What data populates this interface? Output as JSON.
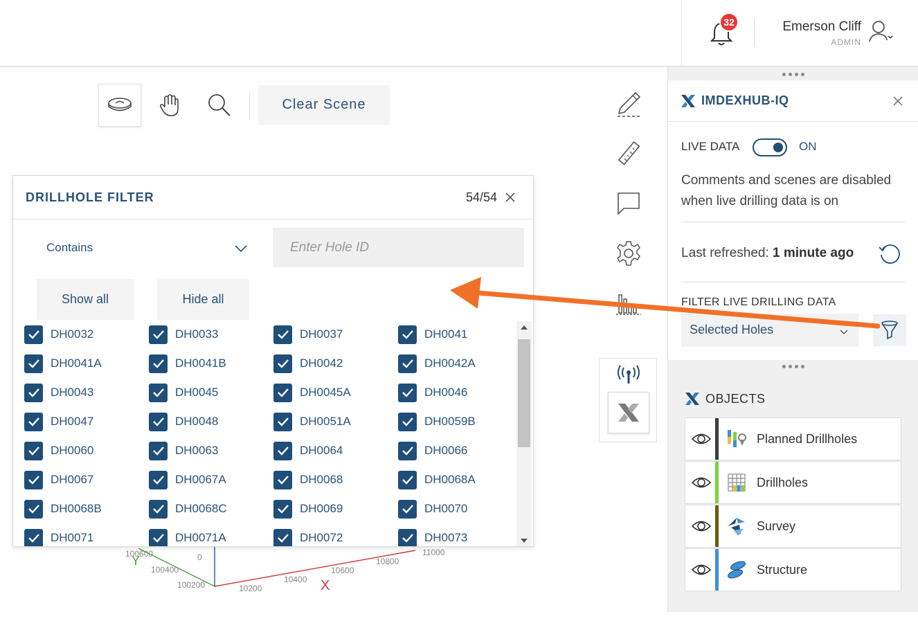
{
  "header": {
    "notification_count": "32",
    "user_name": "Emerson Cliff",
    "user_role": "ADMIN"
  },
  "toolbar": {
    "clear_scene_label": "Clear Scene"
  },
  "axes": {
    "x_label": "X",
    "y_label": "Y",
    "z_zero": "0",
    "x_ticks": [
      "10200",
      "10400",
      "10600",
      "10800",
      "11000"
    ],
    "y_ticks": [
      "100200",
      "100400",
      "100600"
    ]
  },
  "drillhole_filter": {
    "title": "DRILLHOLE FILTER",
    "count": "54/54",
    "mode": "Contains",
    "input_placeholder": "Enter Hole ID",
    "show_all_label": "Show all",
    "hide_all_label": "Hide all",
    "holes": [
      "DH0032",
      "DH0033",
      "DH0037",
      "DH0041",
      "DH0041A",
      "DH0041B",
      "DH0042",
      "DH0042A",
      "DH0043",
      "DH0045",
      "DH0045A",
      "DH0046",
      "DH0047",
      "DH0048",
      "DH0051A",
      "DH0059B",
      "DH0060",
      "DH0063",
      "DH0064",
      "DH0066",
      "DH0067",
      "DH0067A",
      "DH0068",
      "DH0068A",
      "DH0068B",
      "DH0068C",
      "DH0069",
      "DH0070",
      "DH0071",
      "DH0071A",
      "DH0072",
      "DH0073"
    ]
  },
  "imdexhub": {
    "title": "IMDEXHUB-IQ",
    "live_data_label": "LIVE DATA",
    "live_data_state": "ON",
    "live_note": "Comments and scenes are disabled when live drilling data is on",
    "last_refreshed_label": "Last refreshed:",
    "last_refreshed_value": "1 minute ago",
    "filter_label": "FILTER LIVE DRILLING DATA",
    "filter_selected": "Selected Holes"
  },
  "objects": {
    "title": "OBJECTS",
    "items": [
      {
        "label": "Planned Drillholes",
        "color": "#3c3c3c"
      },
      {
        "label": "Drillholes",
        "color": "#7dd33a"
      },
      {
        "label": "Survey",
        "color": "#6b5a12"
      },
      {
        "label": "Structure",
        "color": "#3d8fd6"
      }
    ]
  },
  "colors": {
    "brand_blue": "#1f4e79",
    "accent_orange": "#f07028",
    "badge_red": "#e53935"
  }
}
